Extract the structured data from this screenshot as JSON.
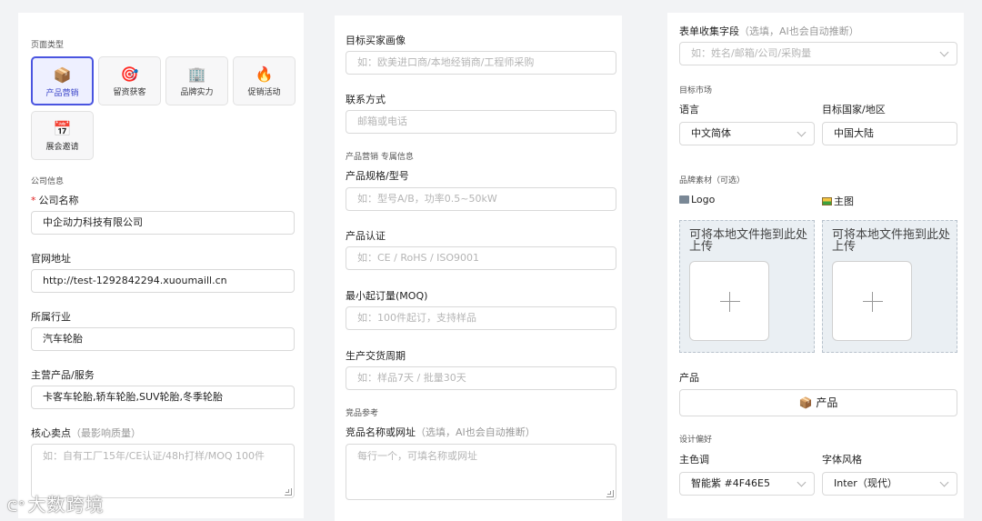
{
  "left": {
    "page_type_label": "页面类型",
    "tiles": [
      {
        "icon": "📦",
        "label": "产品营销",
        "selected": true
      },
      {
        "icon": "🎯",
        "label": "留资获客",
        "selected": false
      },
      {
        "icon": "🏢",
        "label": "品牌实力",
        "selected": false
      },
      {
        "icon": "🔥",
        "label": "促销活动",
        "selected": false
      },
      {
        "icon": "📅",
        "label": "展会邀请",
        "selected": false
      }
    ],
    "company_section": "公司信息",
    "company_name_label": "公司名称",
    "company_name_required": "*",
    "company_name_value": "中企动力科技有限公司",
    "website_label": "官网地址",
    "website_value": "http://test-1292842294.xuoumaill.cn",
    "industry_label": "所属行业",
    "industry_value": "汽车轮胎",
    "products_label": "主营产品/服务",
    "products_value": "卡客车轮胎,轿车轮胎,SUV轮胎,冬季轮胎",
    "selling_label": "核心卖点",
    "selling_hint": "（最影响质量）",
    "selling_placeholder": "如：自有工厂15年/CE认证/48h打样/MOQ 100件"
  },
  "middle": {
    "buyer_label": "目标买家画像",
    "buyer_placeholder": "如：欧美进口商/本地经销商/工程师采购",
    "contact_label": "联系方式",
    "contact_placeholder": "邮箱或电话",
    "product_section": "产品营销 专属信息",
    "spec_label": "产品规格/型号",
    "spec_placeholder": "如：型号A/B，功率0.5~50kW",
    "cert_label": "产品认证",
    "cert_placeholder": "如：CE / RoHS / ISO9001",
    "moq_label": "最小起订量(MOQ)",
    "moq_placeholder": "如：100件起订，支持样品",
    "lead_label": "生产交货周期",
    "lead_placeholder": "如：样品7天 / 批量30天",
    "competitor_section": "竞品参考",
    "competitor_label": "竞品名称或网址",
    "competitor_hint": "（选填，AI也会自动推断）",
    "competitor_placeholder": "每行一个，可填名称或网址"
  },
  "right": {
    "form_fields_label": "表单收集字段",
    "form_fields_hint": "（选填，AI也会自动推断）",
    "form_fields_placeholder": "如：姓名/邮箱/公司/采购量",
    "market_section": "目标市场",
    "language_label": "语言",
    "language_value": "中文简体",
    "country_label": "目标国家/地区",
    "country_value": "中国大陆",
    "brand_section": "品牌素材（可选）",
    "logo_label": "Logo",
    "main_image_label": "主图",
    "drop_text": "可将本地文件拖到此处上传",
    "product_label": "产品",
    "product_button": "📦 产品",
    "design_section": "设计偏好",
    "main_color_label": "主色调",
    "main_color_value": "智能紫 #4F46E5",
    "font_style_label": "字体风格",
    "font_style_value": "Inter（现代）"
  },
  "watermark": "大数跨境",
  "colors": {
    "accent": "#4F46E5",
    "required": "#E02424"
  }
}
